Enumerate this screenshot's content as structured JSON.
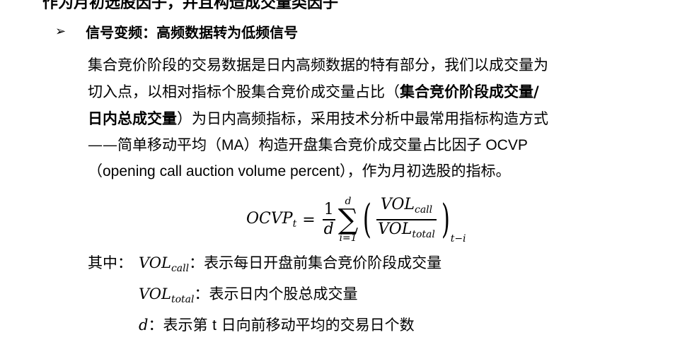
{
  "top_cut_text": "作为月初选股因子，并且构造成交量类因子",
  "heading": {
    "bullet": "➢",
    "text": "信号变频：高频数据转为低频信号"
  },
  "paragraph": {
    "line1": "集合竞价阶段的交易数据是日内高频数据的特有部分，我们以成交量为",
    "line2_pre": "切入点，以相对指标个股集合竞价成交量占比（",
    "line2_bold": "集合竞价阶段成交量/",
    "line3_bold": "日内总成交量",
    "line3_post": "）为日内高频指标，采用技术分析中最常用指标构造方式",
    "line4_pre": "——简单移动平均（",
    "line4_ma": "MA",
    "line4_mid": "）构造开盘集合竞价成交量占比因子",
    "line4_ocvp": " OCVP",
    "line5_paren_open": "（",
    "line5_en": "opening call auction volume percent",
    "line5_post": "），作为月初选股的指标。"
  },
  "formula": {
    "lhs": "OCVP",
    "lhs_sub": "t",
    "eq": "=",
    "frac1_num": "1",
    "frac1_den": "d",
    "sum_upper": "d",
    "sum_lower": "i=1",
    "sum_symbol": "∑",
    "num_var": "VOL",
    "num_sub": "call",
    "den_var": "VOL",
    "den_sub": "total",
    "outer_sub": "t−i",
    "paren_open": "(",
    "paren_close": ")"
  },
  "definitions": {
    "prefix": "其中：",
    "items": [
      {
        "var": "VOL",
        "sub": "call",
        "desc": "：表示每日开盘前集合竞价阶段成交量"
      },
      {
        "var": "VOL",
        "sub": "total",
        "desc": "：表示日内个股总成交量"
      },
      {
        "var": "d",
        "sub": "",
        "desc_pre": "：表示第 ",
        "desc_t": "t",
        "desc_post": " 日向前移动平均的交易日个数"
      }
    ]
  }
}
